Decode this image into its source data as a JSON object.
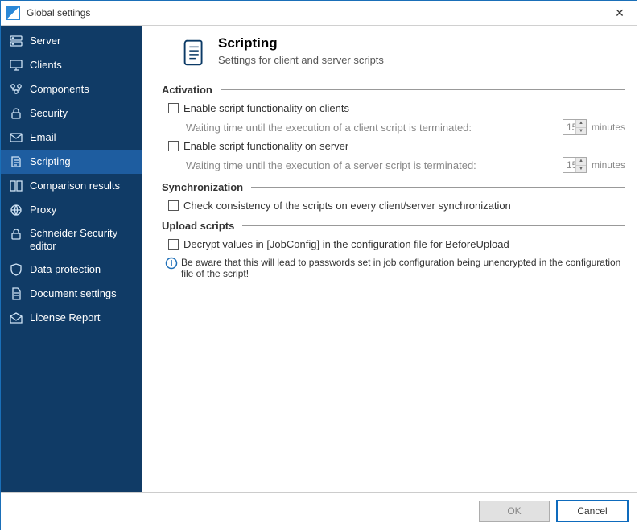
{
  "window": {
    "title": "Global settings"
  },
  "sidebar": {
    "items": [
      {
        "label": "Server"
      },
      {
        "label": "Clients"
      },
      {
        "label": "Components"
      },
      {
        "label": "Security"
      },
      {
        "label": "Email"
      },
      {
        "label": "Scripting"
      },
      {
        "label": "Comparison results"
      },
      {
        "label": "Proxy"
      },
      {
        "label": "Schneider Security editor"
      },
      {
        "label": "Data protection"
      },
      {
        "label": "Document settings"
      },
      {
        "label": "License Report"
      }
    ],
    "active_index": 5
  },
  "page": {
    "title": "Scripting",
    "subtitle": "Settings for client and server scripts"
  },
  "activation": {
    "heading": "Activation",
    "enable_clients_label": "Enable script functionality on clients",
    "client_wait_label": "Waiting time until the execution of a client script is terminated:",
    "client_wait_value": "15",
    "client_wait_unit": "minutes",
    "enable_server_label": "Enable script functionality on server",
    "server_wait_label": "Waiting time until the execution of a server script is terminated:",
    "server_wait_value": "15",
    "server_wait_unit": "minutes"
  },
  "sync": {
    "heading": "Synchronization",
    "check_label": "Check consistency of the scripts on every client/server synchronization"
  },
  "upload": {
    "heading": "Upload scripts",
    "decrypt_label": "Decrypt values in [JobConfig] in the configuration file for BeforeUpload",
    "warning": "Be aware that this will lead to passwords set in job configuration being unencrypted in the configuration file of the script!"
  },
  "footer": {
    "ok": "OK",
    "cancel": "Cancel"
  }
}
